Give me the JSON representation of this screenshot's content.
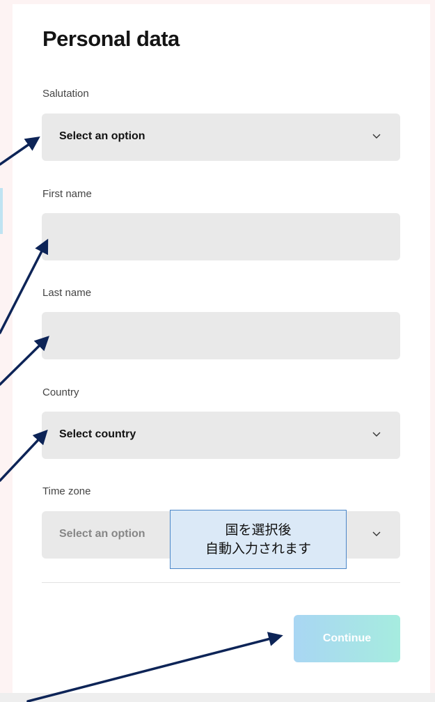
{
  "form": {
    "title": "Personal data",
    "salutation": {
      "label": "Salutation",
      "value": "Select an option"
    },
    "first_name": {
      "label": "First name",
      "value": ""
    },
    "last_name": {
      "label": "Last name",
      "value": ""
    },
    "country": {
      "label": "Country",
      "value": "Select country"
    },
    "time_zone": {
      "label": "Time zone",
      "value": "Select an option"
    },
    "continue_label": "Continue"
  },
  "annotation": {
    "note_line1": "国を選択後",
    "note_line2": "自動入力されます"
  },
  "colors": {
    "field_bg": "#e9e9e9",
    "arrow": "#0d2457",
    "note_bg": "#dbe9f7",
    "note_border": "#4a86c8",
    "continue_gradient_start": "#a9d6f3",
    "continue_gradient_end": "#a6ecdf"
  },
  "icons": [
    "chevron-down-icon",
    "annotation-arrow"
  ]
}
